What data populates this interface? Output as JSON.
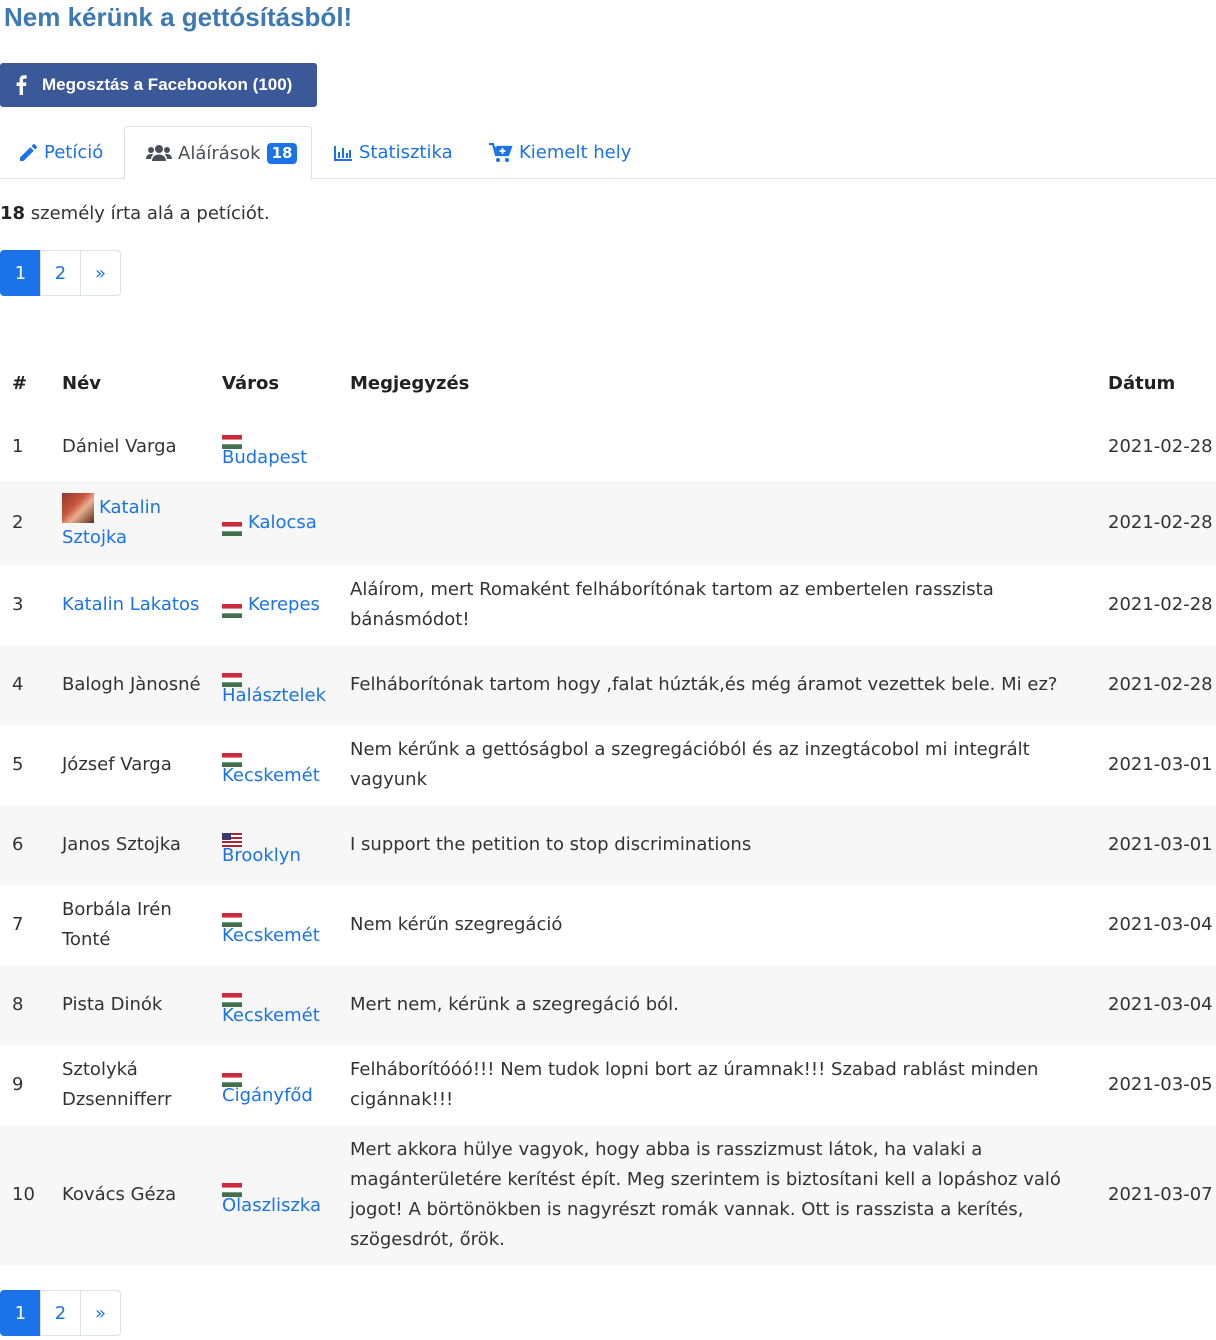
{
  "title": "Nem kérünk a gettósításból!",
  "share_button": "Megosztás a Facebookon (100)",
  "tabs": [
    {
      "label": "Petíció",
      "icon": "pencil-icon"
    },
    {
      "label": "Aláírások",
      "icon": "users-icon",
      "badge": "18"
    },
    {
      "label": "Statisztika",
      "icon": "bar-chart-icon"
    },
    {
      "label": "Kiemelt hely",
      "icon": "cart-plus-icon"
    }
  ],
  "count": {
    "number": "18",
    "text": " személy írta alá a petíciót."
  },
  "pagination": {
    "pages": [
      "1",
      "2"
    ],
    "next": "»"
  },
  "table": {
    "headers": {
      "num": "#",
      "name": "Név",
      "city": "Város",
      "note": "Megjegyzés",
      "date": "Dátum"
    },
    "rows": [
      {
        "num": "1",
        "name": "Dániel Varga",
        "city": "Budapest",
        "note": "",
        "date": "2021-02-28"
      },
      {
        "num": "2",
        "name": "Katalin Sztojka",
        "city": "Kalocsa",
        "note": "",
        "date": "2021-02-28"
      },
      {
        "num": "3",
        "name": "Katalin Lakatos",
        "city": "Kerepes",
        "note": "Aláírom, mert Romaként felháborítónak tartom az embertelen rasszista bánásmódot!",
        "date": "2021-02-28"
      },
      {
        "num": "4",
        "name": "Balogh Jànosné",
        "city": "Halásztelek",
        "note": "Felháborítónak tartom hogy ,falat húzták,és még áramot vezettek bele. Mi ez?",
        "date": "2021-02-28"
      },
      {
        "num": "5",
        "name": "József Varga",
        "city": "Kecskemét",
        "note": "Nem kérűnk a gettóságbol a szegregációból és az inzegtácobol mi integrált vagyunk",
        "date": "2021-03-01"
      },
      {
        "num": "6",
        "name": "Janos Sztojka",
        "city": "Brooklyn",
        "note": "I support the petition to stop discriminations",
        "date": "2021-03-01"
      },
      {
        "num": "7",
        "name": "Borbála Irén Tonté",
        "city": "Kecskemét",
        "note": "Nem kérűn szegregáció",
        "date": "2021-03-04"
      },
      {
        "num": "8",
        "name": "Pista Dinók",
        "city": "Kecskemét",
        "note": "Mert nem, kérünk a szegregáció ból.",
        "date": "2021-03-04"
      },
      {
        "num": "9",
        "name": "Sztolyká Dzsennifferr",
        "city": "Cigányfőd",
        "note": "Felháborítóóó!!! Nem tudok lopni bort az úramnak!!! Szabad rablást minden cigánnak!!!",
        "date": "2021-03-05"
      },
      {
        "num": "10",
        "name": "Kovács Géza",
        "city": "Olaszliszka",
        "note": "Mert akkora hülye vagyok, hogy abba is rasszizmust látok, ha valaki a magánterületére kerítést épít. Meg szerintem is biztosítani kell a lopáshoz való jogot! A börtönökben is nagyrészt romák vannak. Ott is rasszista a kerítés, szögesdrót, őrök.",
        "date": "2021-03-07"
      }
    ]
  }
}
